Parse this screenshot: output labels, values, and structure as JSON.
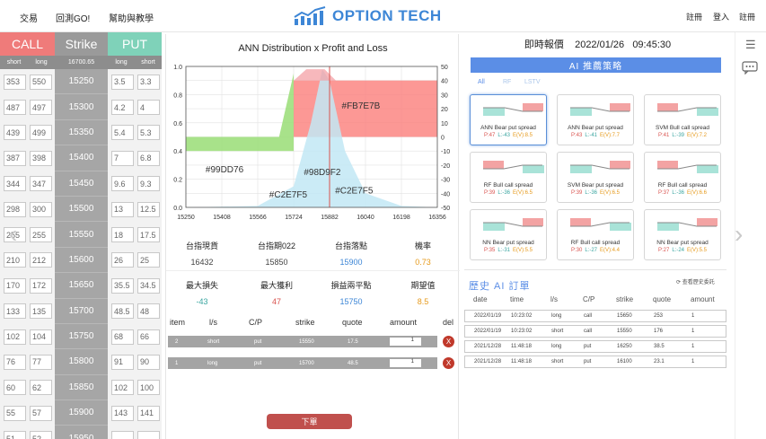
{
  "nav": {
    "trade": "交易",
    "backtest": "回測GO!",
    "help": "幫助與教學"
  },
  "brand": {
    "name": "OPTION TECH"
  },
  "auth": {
    "register": "註冊",
    "login": "登入",
    "signup": "註冊"
  },
  "ladder": {
    "call": "CALL",
    "strike": "Strike",
    "put": "PUT",
    "sub": {
      "c_short": "short",
      "c_long": "long",
      "underlying": "16700.65",
      "p_long": "long",
      "p_short": "short"
    },
    "rows": [
      {
        "cs": "353",
        "cl": "550",
        "k": "15250",
        "pl": "3.5",
        "ps": "3.3"
      },
      {
        "cs": "487",
        "cl": "497",
        "k": "15300",
        "pl": "4.2",
        "ps": "4"
      },
      {
        "cs": "439",
        "cl": "499",
        "k": "15350",
        "pl": "5.4",
        "ps": "5.3"
      },
      {
        "cs": "387",
        "cl": "398",
        "k": "15400",
        "pl": "7",
        "ps": "6.8"
      },
      {
        "cs": "344",
        "cl": "347",
        "k": "15450",
        "pl": "9.6",
        "ps": "9.3"
      },
      {
        "cs": "298",
        "cl": "300",
        "k": "15500",
        "pl": "13",
        "ps": "12.5"
      },
      {
        "cs": "255",
        "cl": "255",
        "k": "15550",
        "pl": "18",
        "ps": "17.5"
      },
      {
        "cs": "210",
        "cl": "212",
        "k": "15600",
        "pl": "26",
        "ps": "25"
      },
      {
        "cs": "170",
        "cl": "172",
        "k": "15650",
        "pl": "35.5",
        "ps": "34.5"
      },
      {
        "cs": "133",
        "cl": "135",
        "k": "15700",
        "pl": "48.5",
        "ps": "48"
      },
      {
        "cs": "102",
        "cl": "104",
        "k": "15750",
        "pl": "68",
        "ps": "66"
      },
      {
        "cs": "76",
        "cl": "77",
        "k": "15800",
        "pl": "91",
        "ps": "90"
      },
      {
        "cs": "60",
        "cl": "62",
        "k": "15850",
        "pl": "102",
        "ps": "100"
      },
      {
        "cs": "55",
        "cl": "57",
        "k": "15900",
        "pl": "143",
        "ps": "141"
      },
      {
        "cs": "51",
        "cl": "52",
        "k": "15950",
        "pl": "",
        "ps": ""
      }
    ]
  },
  "chart": {
    "title": "ANN Distribution x Profit and Loss",
    "left_ticks": [
      "1.0",
      "0.8",
      "0.6",
      "0.4",
      "0.2",
      "0.0"
    ],
    "right_ticks": [
      "50",
      "40",
      "30",
      "20",
      "10",
      "0",
      "-10",
      "-20",
      "-30",
      "-40",
      "-50"
    ],
    "x_ticks": [
      "15250",
      "15408",
      "15566",
      "15724",
      "15882",
      "16040",
      "16198",
      "16356"
    ],
    "labels": {
      "c1": "#FB7E7B",
      "c2": "#99DD76",
      "c3": "#98D9F2",
      "c4": "#C2E7F5",
      "c5": "#C2E7F5"
    },
    "colors": {
      "red": "#FB7E7B",
      "green": "#99DD76",
      "blue": "#98D9F2",
      "lightblue": "#C2E7F5"
    }
  },
  "chart_data": {
    "type": "area",
    "title": "ANN Distribution x Profit and Loss",
    "xlim": [
      15250,
      16356
    ],
    "ylim_left": [
      0,
      1
    ],
    "ylim_right": [
      -50,
      50
    ],
    "series": [
      {
        "name": "#99DD76",
        "x": [
          15250,
          15724
        ],
        "values": [
          -10,
          -10
        ]
      },
      {
        "name": "#FB7E7B",
        "x": [
          15724,
          16356
        ],
        "values": [
          40,
          40
        ]
      },
      {
        "name": "#98D9F2",
        "x": [
          15250,
          15566,
          15724,
          15800,
          15850,
          15882,
          15950,
          16040,
          16198,
          16356
        ],
        "values": [
          0,
          0.01,
          0.15,
          0.6,
          0.98,
          0.9,
          0.4,
          0.1,
          0.01,
          0
        ]
      }
    ],
    "vline_x": 15882
  },
  "stats1": [
    {
      "label": "台指現貨",
      "value": "16432",
      "color": "#444"
    },
    {
      "label": "台指期022",
      "value": "15850",
      "color": "#444"
    },
    {
      "label": "台指落點",
      "value": "15900",
      "color": "#3d86d6"
    },
    {
      "label": "機率",
      "value": "0.73",
      "color": "#e69a1c"
    }
  ],
  "stats2": [
    {
      "label": "最大損失",
      "value": "-43",
      "color": "#3aa5a0"
    },
    {
      "label": "最大獲利",
      "value": "47",
      "color": "#d9534f"
    },
    {
      "label": "損益兩平點",
      "value": "15750",
      "color": "#3d86d6"
    },
    {
      "label": "期望值",
      "value": "8.5",
      "color": "#e69a1c"
    }
  ],
  "orders": {
    "headers": {
      "item": "item",
      "ls": "l/s",
      "cp": "C/P",
      "strike": "strike",
      "quote": "quote",
      "amount": "amount",
      "del": "del"
    },
    "rows": [
      {
        "item": "2",
        "ls": "short",
        "cp": "put",
        "strike": "15550",
        "quote": "17.5",
        "amount": "1",
        "del": "X"
      },
      {
        "item": "1",
        "ls": "long",
        "cp": "put",
        "strike": "15700",
        "quote": "48.5",
        "amount": "1",
        "del": "X"
      }
    ],
    "submit": "下單"
  },
  "quote": {
    "label": "即時報價",
    "date": "2022/01/26",
    "time": "09:45:30"
  },
  "ai": {
    "title": "AI 推薦策略",
    "tabs": [
      "All",
      "RF",
      "LSTV"
    ]
  },
  "cards": [
    {
      "name": "ANN Bear put spread",
      "p": "P:47",
      "l": "L:-43",
      "e": "E(V):8.5",
      "ptype": "bear"
    },
    {
      "name": "ANN Bear put spread",
      "p": "P:43",
      "l": "L:-41",
      "e": "E(V):7.7",
      "ptype": "bear"
    },
    {
      "name": "SVM Bull call spread",
      "p": "P:41",
      "l": "L:-39",
      "e": "E(V):7.2",
      "ptype": "bull"
    },
    {
      "name": "RF Bull call spread",
      "p": "P:39",
      "l": "L:-36",
      "e": "E(V):6.5",
      "ptype": "bull"
    },
    {
      "name": "SVM Bear put spread",
      "p": "P:39",
      "l": "L:-36",
      "e": "E(V):6.5",
      "ptype": "bear"
    },
    {
      "name": "RF Bull call spread",
      "p": "P:37",
      "l": "L:-36",
      "e": "E(V):6.6",
      "ptype": "bull"
    },
    {
      "name": "NN Bear put spread",
      "p": "P:35",
      "l": "L:-31",
      "e": "E(V):5.5",
      "ptype": "bear"
    },
    {
      "name": "RF Bull call spread",
      "p": "P:30",
      "l": "L:-27",
      "e": "E(V):4.4",
      "ptype": "bull"
    },
    {
      "name": "NN Bear put spread",
      "p": "P:27",
      "l": "L:-24",
      "e": "E(V):5.5",
      "ptype": "bear"
    }
  ],
  "history": {
    "title": "歷史 AI 訂單",
    "link": "查看歷史委託",
    "headers": [
      "date",
      "time",
      "l/s",
      "C/P",
      "strike",
      "quote",
      "amount"
    ],
    "rows": [
      [
        "2022/01/19",
        "10:23:02",
        "long",
        "call",
        "15650",
        "253",
        "1"
      ],
      [
        "2022/01/19",
        "10:23:02",
        "short",
        "call",
        "15550",
        "176",
        "1"
      ],
      [
        "2021/12/28",
        "11:48:18",
        "long",
        "put",
        "16250",
        "38.5",
        "1"
      ],
      [
        "2021/12/28",
        "11:48:18",
        "short",
        "put",
        "16100",
        "23.1",
        "1"
      ]
    ]
  }
}
